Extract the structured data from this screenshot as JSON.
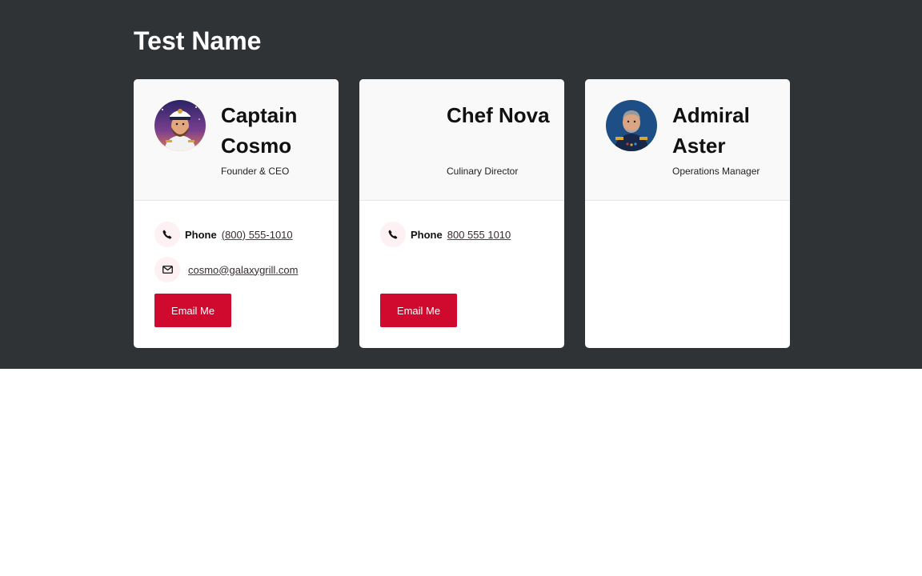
{
  "page": {
    "title": "Test Name"
  },
  "accent_color": "#d0092f",
  "cards": [
    {
      "name": "Captain Cosmo",
      "role": "Founder & CEO",
      "avatar": "captain-avatar",
      "phone_label": "Phone",
      "phone": "(800) 555-1010",
      "email": "cosmo@galaxygrill.com",
      "button": "Email Me"
    },
    {
      "name": "Chef Nova",
      "role": "Culinary Director",
      "phone_label": "Phone",
      "phone": "800 555 1010",
      "button": "Email Me"
    },
    {
      "name": "Admiral Aster",
      "role": "Operations Manager",
      "avatar": "admiral-avatar"
    }
  ],
  "icons": {
    "phone": "phone-icon",
    "email": "envelope-icon"
  }
}
